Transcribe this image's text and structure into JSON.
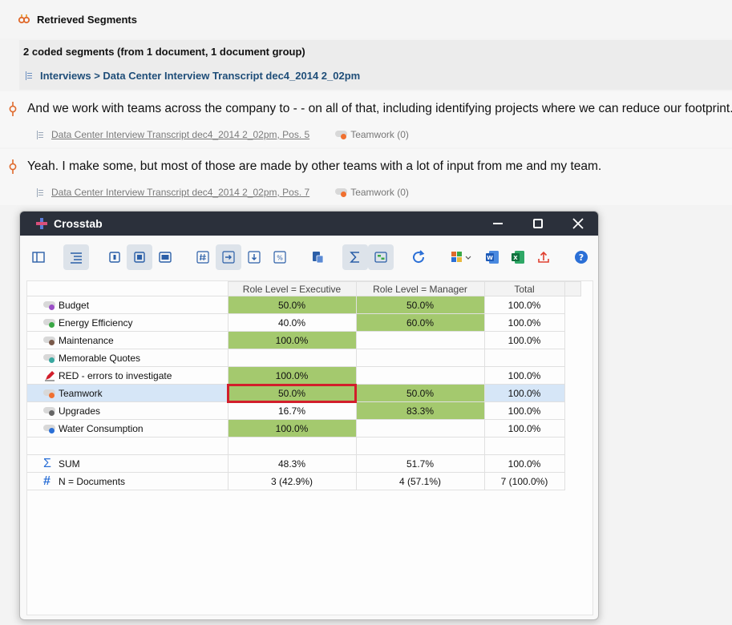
{
  "retrieved": {
    "title": "Retrieved Segments",
    "count_text": "2 coded segments (from 1 document, 1 document group)",
    "path": "Interviews > Data Center Interview Transcript dec4_2014 2_02pm",
    "segments": [
      {
        "text": "And we work with teams across the company to - - on all of that, including identifying projects where we can reduce our footprint.",
        "source": "Data Center Interview Transcript dec4_2014 2_02pm, Pos. 5",
        "code": "Teamwork (0)"
      },
      {
        "text": "Yeah.  I make some, but most of those are made by other teams with a lot of input from me and my team.",
        "source": "Data Center Interview Transcript dec4_2014 2_02pm, Pos. 7",
        "code": "Teamwork (0)"
      }
    ]
  },
  "crosstab": {
    "title": "Crosstab",
    "columns": [
      "Role Level = Executive",
      "Role Level = Manager",
      "Total"
    ],
    "rows": [
      {
        "label": "Budget",
        "dot": "#9b4fc7",
        "values": [
          "50.0%",
          "50.0%",
          "100.0%"
        ]
      },
      {
        "label": "Energy Efficiency",
        "dot": "#3aa845",
        "values": [
          "40.0%",
          "60.0%",
          "100.0%"
        ]
      },
      {
        "label": "Maintenance",
        "dot": "#7a5a4a",
        "values": [
          "100.0%",
          "",
          "100.0%"
        ]
      },
      {
        "label": "Memorable Quotes",
        "dot": "#3aa8a0",
        "values": [
          "",
          "",
          ""
        ]
      },
      {
        "label": "RED - errors to investigate",
        "dot": "#d21e2b",
        "values": [
          "100.0%",
          "",
          "100.0%"
        ]
      },
      {
        "label": "Teamwork",
        "dot": "#f07030",
        "values": [
          "50.0%",
          "50.0%",
          "100.0%"
        ]
      },
      {
        "label": "Upgrades",
        "dot": "#666666",
        "values": [
          "16.7%",
          "83.3%",
          "100.0%"
        ]
      },
      {
        "label": "Water Consumption",
        "dot": "#2a6fd6",
        "values": [
          "100.0%",
          "",
          "100.0%"
        ]
      }
    ],
    "sum": {
      "label": "SUM",
      "values": [
        "48.3%",
        "51.7%",
        "100.0%"
      ]
    },
    "n": {
      "label": "N = Documents",
      "values": [
        "3 (42.9%)",
        "4 (57.1%)",
        "7 (100.0%)"
      ]
    },
    "highlight_color": "#a4c96e",
    "selection_color": "#d6e6f7"
  }
}
